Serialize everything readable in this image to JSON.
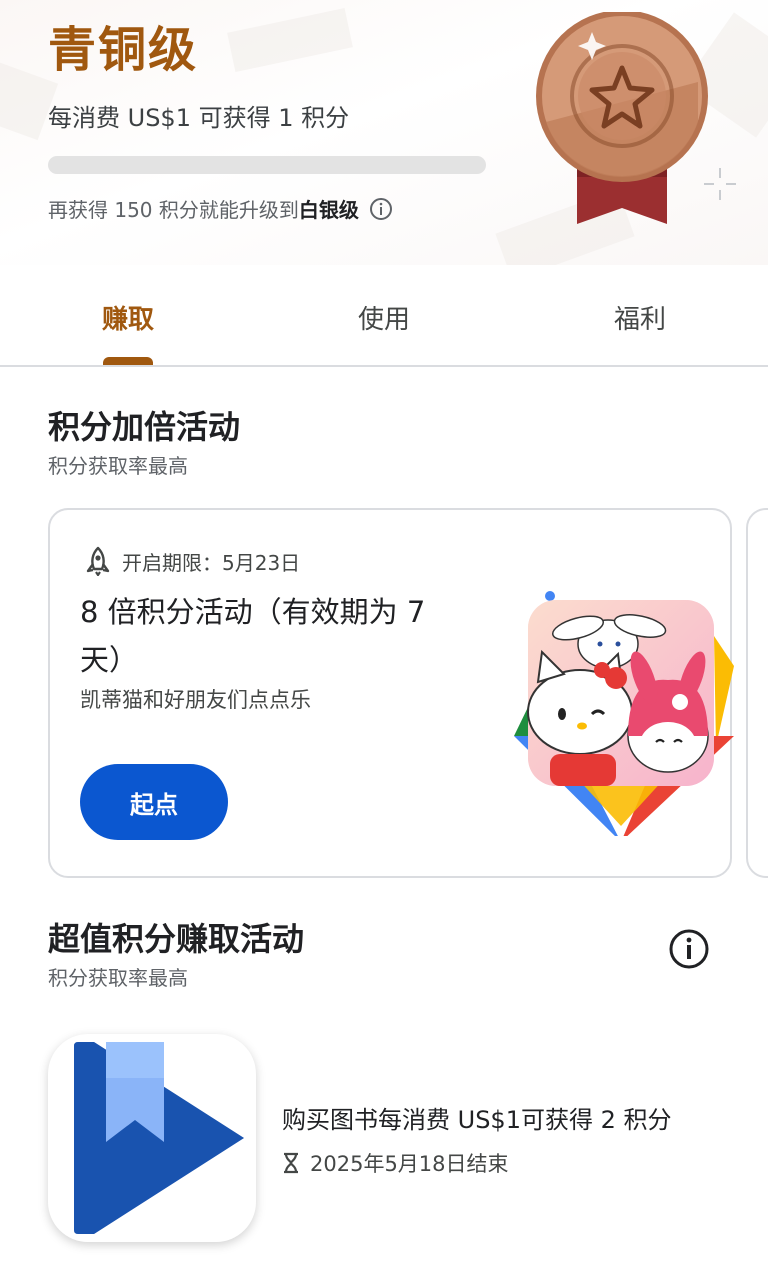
{
  "tier": {
    "name": "青铜级",
    "rate": "每消费 US$1 可获得 1 积分",
    "progress_fraction": 0,
    "upgrade_prefix": "再获得 150 积分就能升级到",
    "upgrade_target": "白银级",
    "colors": {
      "brand": "#a0580f",
      "medal": "#c98c68",
      "ribbon": "#9b2f30"
    }
  },
  "tabs": [
    {
      "label": "赚取",
      "active": true
    },
    {
      "label": "使用",
      "active": false
    },
    {
      "label": "福利",
      "active": false
    }
  ],
  "boost_section": {
    "title": "积分加倍活动",
    "subtitle": "积分获取率最高",
    "card": {
      "deadline": "开启期限：5月23日",
      "title": "8 倍积分活动（有效期为 7 天）",
      "game": "凯蒂猫和好朋友们点点乐",
      "button": "起点"
    }
  },
  "value_section": {
    "title": "超值积分赚取活动",
    "subtitle": "积分获取率最高",
    "offer": {
      "title": "购买图书每消费 US$1可获得 2 积分",
      "end": "2025年5月18日结束"
    }
  },
  "icons": {
    "info": "info-icon",
    "rocket": "rocket-icon",
    "hourglass": "hourglass-icon",
    "books": "google-play-books-icon",
    "medal": "bronze-medal-icon"
  },
  "button_color": "#0b57d0"
}
